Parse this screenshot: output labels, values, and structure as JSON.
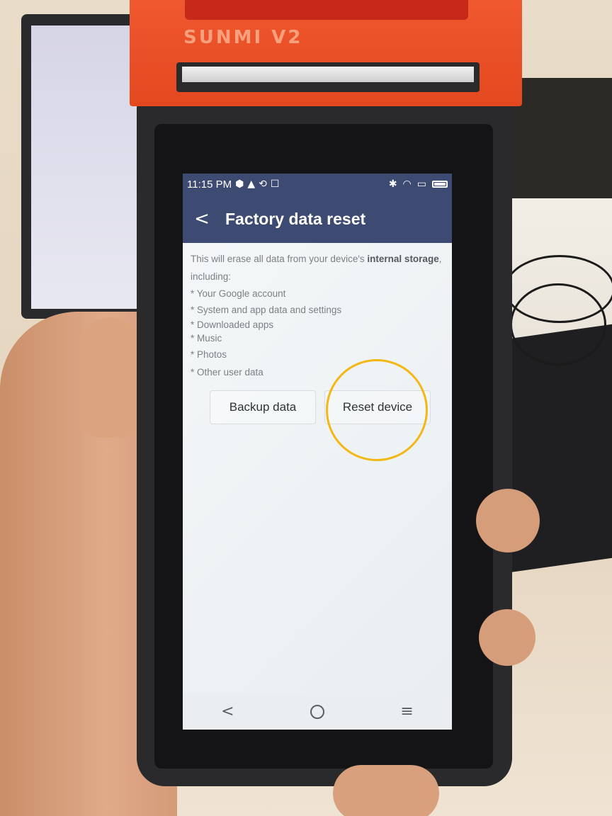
{
  "device": {
    "brand_label": "SUNMI V2"
  },
  "status_bar": {
    "time": "11:15 PM"
  },
  "app_bar": {
    "title": "Factory data reset"
  },
  "content": {
    "intro_prefix": "This will erase all data from your device's ",
    "intro_bold": "internal storage",
    "intro_suffix": ",",
    "including": "including:",
    "items": [
      "* Your Google account",
      "* System and app data and settings",
      "* Downloaded apps",
      "* Music",
      "* Photos",
      "* Other user data"
    ]
  },
  "buttons": {
    "backup_label": "Backup data",
    "reset_label": "Reset device"
  },
  "colors": {
    "app_bar": "#3d4a72",
    "highlight": "#f3b716",
    "printer": "#e4481f"
  }
}
